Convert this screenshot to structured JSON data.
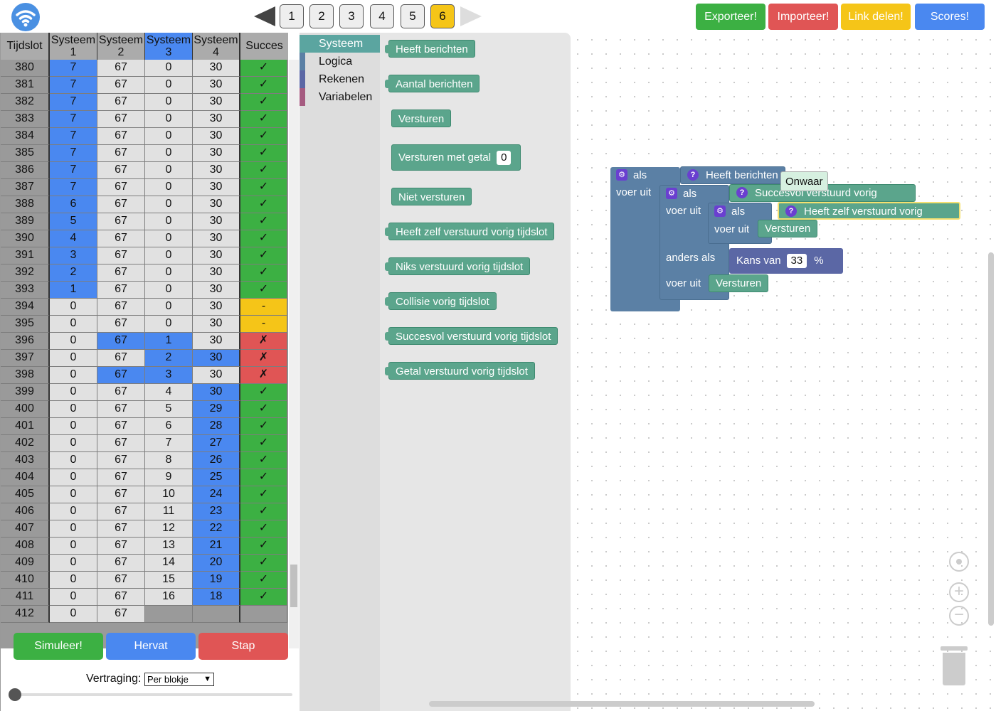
{
  "toolbar": {
    "levels": [
      "1",
      "2",
      "3",
      "4",
      "5",
      "6"
    ],
    "active_level": "6",
    "export_label": "Exporteer!",
    "import_label": "Importeer!",
    "share_label": "Link delen!",
    "scores_label": "Scores!"
  },
  "table": {
    "headers": {
      "slot": "Tijdslot",
      "s1": "Systeem 1",
      "s2": "Systeem 2",
      "s3": "Systeem 3",
      "s4": "Systeem 4",
      "succes": "Succes"
    },
    "rows": [
      {
        "slot": "380",
        "s1": "7",
        "s2": "67",
        "s3": "0",
        "s4": "30",
        "succes": "✓"
      },
      {
        "slot": "381",
        "s1": "7",
        "s2": "67",
        "s3": "0",
        "s4": "30",
        "succes": "✓"
      },
      {
        "slot": "382",
        "s1": "7",
        "s2": "67",
        "s3": "0",
        "s4": "30",
        "succes": "✓"
      },
      {
        "slot": "383",
        "s1": "7",
        "s2": "67",
        "s3": "0",
        "s4": "30",
        "succes": "✓"
      },
      {
        "slot": "384",
        "s1": "7",
        "s2": "67",
        "s3": "0",
        "s4": "30",
        "succes": "✓"
      },
      {
        "slot": "385",
        "s1": "7",
        "s2": "67",
        "s3": "0",
        "s4": "30",
        "succes": "✓"
      },
      {
        "slot": "386",
        "s1": "7",
        "s2": "67",
        "s3": "0",
        "s4": "30",
        "succes": "✓"
      },
      {
        "slot": "387",
        "s1": "7",
        "s2": "67",
        "s3": "0",
        "s4": "30",
        "succes": "✓"
      },
      {
        "slot": "388",
        "s1": "6",
        "s2": "67",
        "s3": "0",
        "s4": "30",
        "succes": "✓"
      },
      {
        "slot": "389",
        "s1": "5",
        "s2": "67",
        "s3": "0",
        "s4": "30",
        "succes": "✓"
      },
      {
        "slot": "390",
        "s1": "4",
        "s2": "67",
        "s3": "0",
        "s4": "30",
        "succes": "✓"
      },
      {
        "slot": "391",
        "s1": "3",
        "s2": "67",
        "s3": "0",
        "s4": "30",
        "succes": "✓"
      },
      {
        "slot": "392",
        "s1": "2",
        "s2": "67",
        "s3": "0",
        "s4": "30",
        "succes": "✓"
      },
      {
        "slot": "393",
        "s1": "1",
        "s2": "67",
        "s3": "0",
        "s4": "30",
        "succes": "✓"
      },
      {
        "slot": "394",
        "s1": "0",
        "s2": "67",
        "s3": "0",
        "s4": "30",
        "succes": "-"
      },
      {
        "slot": "395",
        "s1": "0",
        "s2": "67",
        "s3": "0",
        "s4": "30",
        "succes": "-"
      },
      {
        "slot": "396",
        "s1": "0",
        "s2": "67",
        "s3": "1",
        "s4": "30",
        "succes": "✗"
      },
      {
        "slot": "397",
        "s1": "0",
        "s2": "67",
        "s3": "2",
        "s4": "30",
        "succes": "✗"
      },
      {
        "slot": "398",
        "s1": "0",
        "s2": "67",
        "s3": "3",
        "s4": "30",
        "succes": "✗"
      },
      {
        "slot": "399",
        "s1": "0",
        "s2": "67",
        "s3": "4",
        "s4": "30",
        "succes": "✓"
      },
      {
        "slot": "400",
        "s1": "0",
        "s2": "67",
        "s3": "5",
        "s4": "29",
        "succes": "✓"
      },
      {
        "slot": "401",
        "s1": "0",
        "s2": "67",
        "s3": "6",
        "s4": "28",
        "succes": "✓"
      },
      {
        "slot": "402",
        "s1": "0",
        "s2": "67",
        "s3": "7",
        "s4": "27",
        "succes": "✓"
      },
      {
        "slot": "403",
        "s1": "0",
        "s2": "67",
        "s3": "8",
        "s4": "26",
        "succes": "✓"
      },
      {
        "slot": "404",
        "s1": "0",
        "s2": "67",
        "s3": "9",
        "s4": "25",
        "succes": "✓"
      },
      {
        "slot": "405",
        "s1": "0",
        "s2": "67",
        "s3": "10",
        "s4": "24",
        "succes": "✓"
      },
      {
        "slot": "406",
        "s1": "0",
        "s2": "67",
        "s3": "11",
        "s4": "23",
        "succes": "✓"
      },
      {
        "slot": "407",
        "s1": "0",
        "s2": "67",
        "s3": "12",
        "s4": "22",
        "succes": "✓"
      },
      {
        "slot": "408",
        "s1": "0",
        "s2": "67",
        "s3": "13",
        "s4": "21",
        "succes": "✓"
      },
      {
        "slot": "409",
        "s1": "0",
        "s2": "67",
        "s3": "14",
        "s4": "20",
        "succes": "✓"
      },
      {
        "slot": "410",
        "s1": "0",
        "s2": "67",
        "s3": "15",
        "s4": "19",
        "succes": "✓"
      },
      {
        "slot": "411",
        "s1": "0",
        "s2": "67",
        "s3": "16",
        "s4": "18",
        "succes": "✓"
      },
      {
        "slot": "412",
        "s1": "0",
        "s2": "67",
        "s3": "",
        "s4": "",
        "succes": ""
      }
    ]
  },
  "controls": {
    "simulate_label": "Simuleer!",
    "resume_label": "Hervat",
    "step_label": "Stap",
    "delay_label": "Vertraging:",
    "delay_value": "Per blokje",
    "delay_slider": 0
  },
  "toolbox": {
    "categories": [
      "Systeem",
      "Logica",
      "Rekenen",
      "Variabelen"
    ]
  },
  "flyout": {
    "blocks": [
      "Heeft berichten",
      "Aantal berichten",
      "Versturen",
      "Versturen met getal",
      "Niet versturen",
      "Heeft zelf verstuurd vorig tijdslot",
      "Niks verstuurd vorig tijdslot",
      "Collisie vorig tijdslot",
      "Succesvol verstuurd vorig tijdslot",
      "Getal verstuurd vorig tijdslot"
    ],
    "number_default": "0"
  },
  "workspace": {
    "if_label": "als",
    "do_label": "voer uit",
    "elseif_label": "anders als",
    "cond1": "Heeft berichten",
    "cond2": "Succesvol verstuurd vorig tijdslot",
    "cond3": "Heeft zelf verstuurd vorig tijdslot",
    "send1": "Versturen",
    "send2": "Versturen",
    "chance_label": "Kans van",
    "chance_value": "33",
    "chance_unit": "%",
    "tooltip": "Onwaar"
  },
  "colors": {
    "green": "#3cb043",
    "red": "#e05555",
    "yellow": "#f5c518",
    "blue": "#4a88f0",
    "block_green": "#5ba58c",
    "block_blue": "#5b80a5",
    "block_purple": "#5b67a5"
  }
}
